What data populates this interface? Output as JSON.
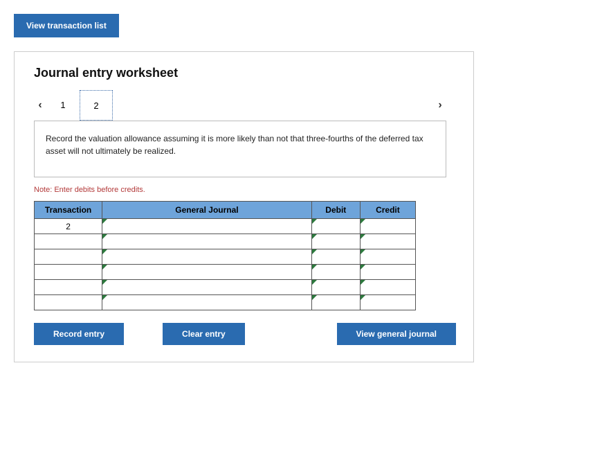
{
  "topButton": "View transaction list",
  "title": "Journal entry worksheet",
  "pager": {
    "tabs": [
      "1",
      "2"
    ],
    "activeIndex": 1
  },
  "prompt": "Record the valuation allowance assuming it is more likely than not that three-fourths of the deferred tax asset will not ultimately be realized.",
  "note": "Note: Enter debits before credits.",
  "table": {
    "headers": {
      "transaction": "Transaction",
      "gj": "General Journal",
      "debit": "Debit",
      "credit": "Credit"
    },
    "rows": [
      {
        "transaction": "2",
        "gj": "",
        "debit": "",
        "credit": ""
      },
      {
        "transaction": "",
        "gj": "",
        "debit": "",
        "credit": ""
      },
      {
        "transaction": "",
        "gj": "",
        "debit": "",
        "credit": ""
      },
      {
        "transaction": "",
        "gj": "",
        "debit": "",
        "credit": ""
      },
      {
        "transaction": "",
        "gj": "",
        "debit": "",
        "credit": ""
      },
      {
        "transaction": "",
        "gj": "",
        "debit": "",
        "credit": ""
      }
    ]
  },
  "buttons": {
    "record": "Record entry",
    "clear": "Clear entry",
    "view": "View general journal"
  }
}
